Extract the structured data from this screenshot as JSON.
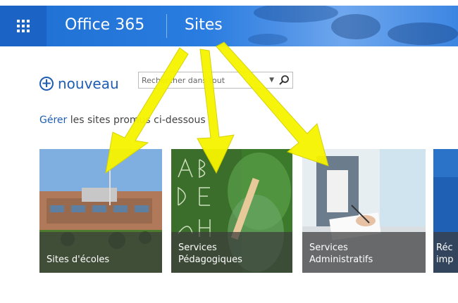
{
  "suite_bar": {
    "app_title": "Office 365",
    "section_title": "Sites",
    "waffle_icon": "app-launcher-icon",
    "color": "#2a7de0"
  },
  "actions": {
    "new_label": "nouveau",
    "new_icon": "plus-circle-icon"
  },
  "search": {
    "placeholder": "Rechercher dans tout",
    "icon": "search-icon"
  },
  "manage": {
    "link_text": "Gérer",
    "rest_text": " les sites promus ci-dessous"
  },
  "tiles": [
    {
      "label_line1": "Sites d'écoles",
      "label_line2": ""
    },
    {
      "label_line1": "Services",
      "label_line2": "Pédagogiques"
    },
    {
      "label_line1": "Services",
      "label_line2": "Administratifs"
    },
    {
      "label_line1": "Réc",
      "label_line2": "imp"
    }
  ],
  "annotation": {
    "arrow_color": "#f7f400"
  }
}
